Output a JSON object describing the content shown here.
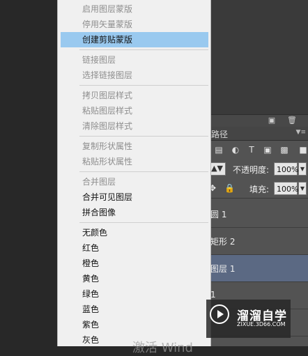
{
  "menu": {
    "items": [
      {
        "label": "启用图层蒙版",
        "state": "disabled"
      },
      {
        "label": "停用矢量蒙版",
        "state": "disabled"
      },
      {
        "label": "创建剪贴蒙版",
        "state": "highlighted"
      },
      {
        "label": "链接图层",
        "state": "disabled"
      },
      {
        "label": "选择链接图层",
        "state": "disabled"
      },
      {
        "label": "拷贝图层样式",
        "state": "disabled"
      },
      {
        "label": "粘贴图层样式",
        "state": "disabled"
      },
      {
        "label": "清除图层样式",
        "state": "disabled"
      },
      {
        "label": "复制形状属性",
        "state": "disabled"
      },
      {
        "label": "粘贴形状属性",
        "state": "disabled"
      },
      {
        "label": "合并图层",
        "state": "disabled"
      },
      {
        "label": "合并可见图层",
        "state": "enabled"
      },
      {
        "label": "拼合图像",
        "state": "enabled"
      },
      {
        "label": "无颜色",
        "state": "enabled"
      },
      {
        "label": "红色",
        "state": "enabled"
      },
      {
        "label": "橙色",
        "state": "enabled"
      },
      {
        "label": "黄色",
        "state": "enabled"
      },
      {
        "label": "绿色",
        "state": "enabled"
      },
      {
        "label": "蓝色",
        "state": "enabled"
      },
      {
        "label": "紫色",
        "state": "enabled"
      },
      {
        "label": "灰色",
        "state": "enabled"
      }
    ]
  },
  "layers_panel": {
    "tab_label": "路径",
    "opacity_label": "不透明度:",
    "opacity_value": "100%",
    "fill_label": "填充:",
    "fill_value": "100%",
    "layers": [
      {
        "name": "圆 1",
        "selected": false
      },
      {
        "name": "矩形 2",
        "selected": false
      },
      {
        "name": "图层 1",
        "selected": true
      },
      {
        "name": "1",
        "selected": false
      }
    ]
  },
  "watermark": {
    "title": "溜溜自学",
    "subtitle": "ZIXUE.3D66.COM"
  },
  "activate_text": "激活 Wind"
}
